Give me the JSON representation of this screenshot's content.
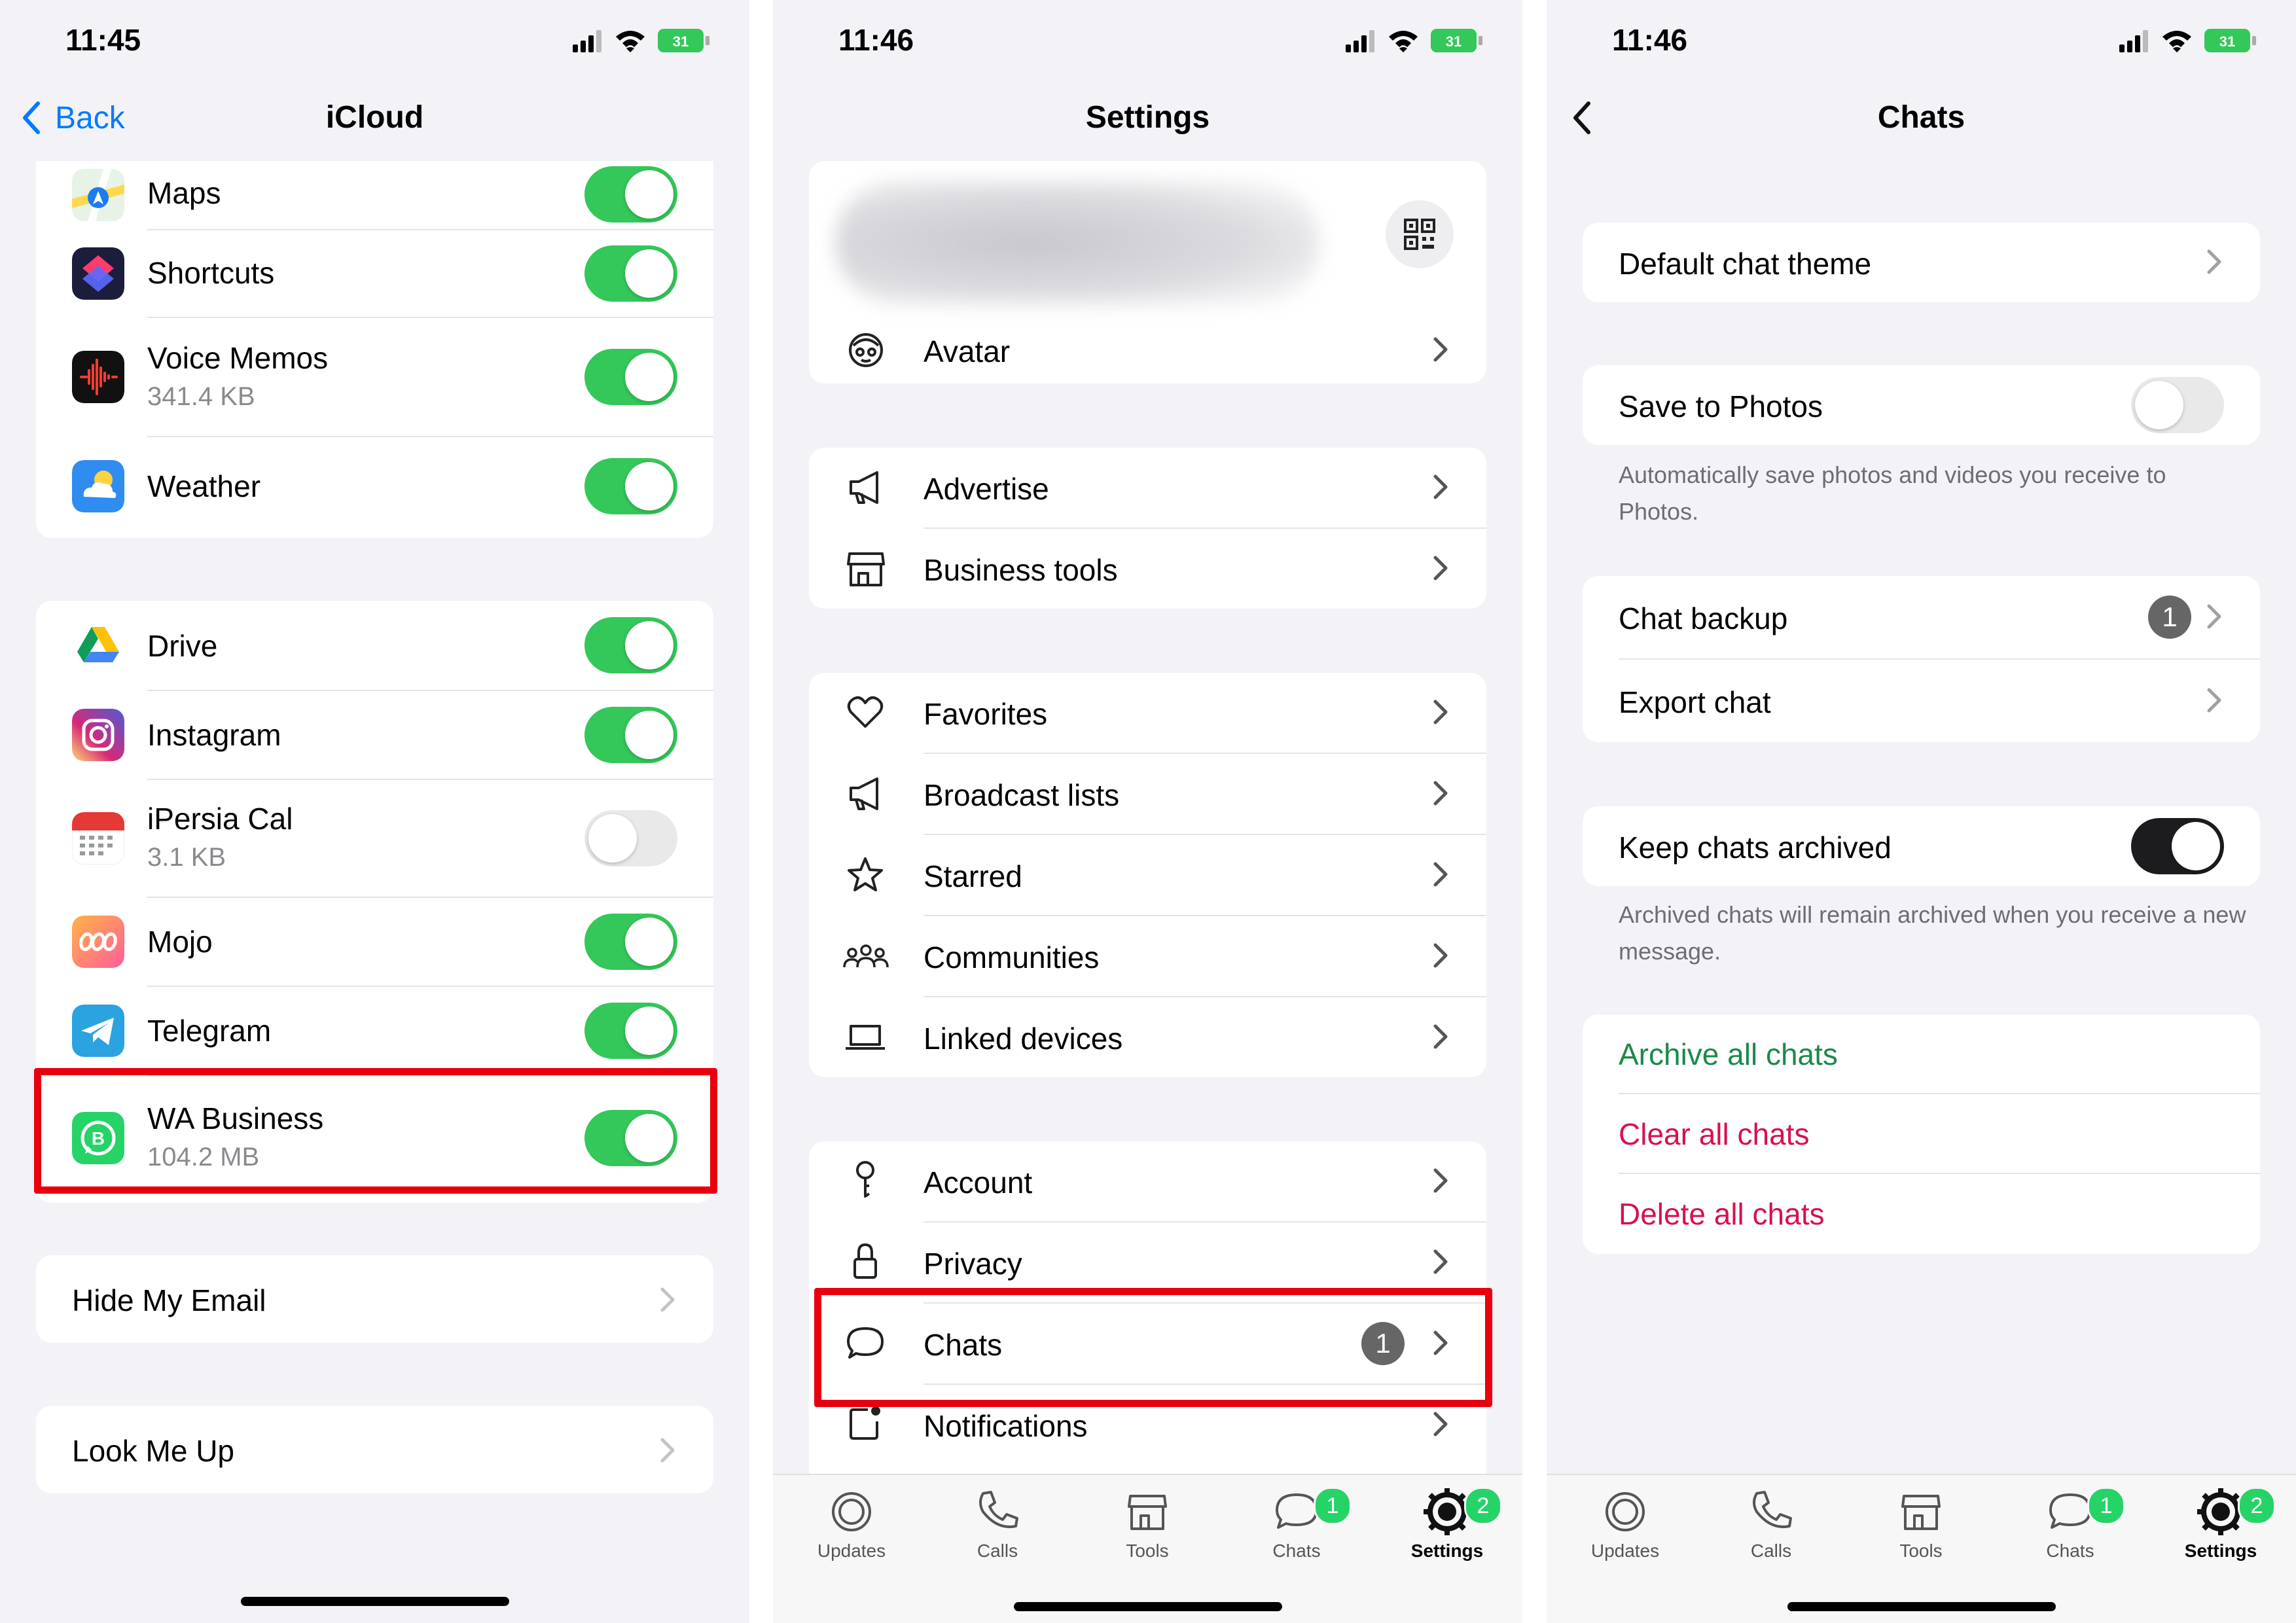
{
  "panels": [
    {
      "time": "11:45",
      "battery": "31",
      "back_label": "Back",
      "title": "iCloud",
      "apps_top": [
        {
          "name": "Maps",
          "icon": "maps-icon",
          "toggle": "on"
        },
        {
          "name": "Shortcuts",
          "icon": "shortcuts-icon",
          "toggle": "on"
        },
        {
          "name": "Voice Memos",
          "detail": "341.4 KB",
          "icon": "voice-memos-icon",
          "toggle": "on"
        },
        {
          "name": "Weather",
          "icon": "weather-icon",
          "toggle": "on"
        }
      ],
      "apps_third_party": [
        {
          "name": "Drive",
          "icon": "drive-icon",
          "toggle": "on"
        },
        {
          "name": "Instagram",
          "icon": "instagram-icon",
          "toggle": "on"
        },
        {
          "name": "iPersia Cal",
          "detail": "3.1 KB",
          "icon": "calendar-icon",
          "toggle": "off"
        },
        {
          "name": "Mojo",
          "icon": "mojo-icon",
          "toggle": "on"
        },
        {
          "name": "Telegram",
          "icon": "telegram-icon",
          "toggle": "on"
        },
        {
          "name": "WA Business",
          "detail": "104.2 MB",
          "icon": "whatsapp-business-icon",
          "toggle": "on",
          "highlighted": true
        }
      ],
      "hide_my_email": "Hide My Email",
      "look_me_up": "Look Me Up"
    },
    {
      "time": "11:46",
      "battery": "31",
      "title": "Settings",
      "avatar_label": "Avatar",
      "business_items": [
        "Advertise",
        "Business tools"
      ],
      "list_items": [
        "Favorites",
        "Broadcast lists",
        "Starred",
        "Communities",
        "Linked devices"
      ],
      "account_items": [
        "Account",
        "Privacy",
        "Chats",
        "Notifications"
      ],
      "chats_badge": "1",
      "tabs": [
        "Updates",
        "Calls",
        "Tools",
        "Chats",
        "Settings"
      ],
      "chats_tab_badge": "1",
      "settings_tab_badge": "2"
    },
    {
      "time": "11:46",
      "battery": "31",
      "title": "Chats",
      "default_theme": "Default chat theme",
      "save_to_photos": "Save to Photos",
      "save_note": "Automatically save photos and videos you receive to Photos.",
      "chat_backup": "Chat backup",
      "chat_backup_badge": "1",
      "export_chat": "Export chat",
      "keep_archived": "Keep chats archived",
      "archived_note": "Archived chats will remain archived when you receive a new message.",
      "archive_all": "Archive all chats",
      "clear_all": "Clear all chats",
      "delete_all": "Delete all chats",
      "tabs": [
        "Updates",
        "Calls",
        "Tools",
        "Chats",
        "Settings"
      ],
      "chats_tab_badge": "1",
      "settings_tab_badge": "2"
    }
  ],
  "colors": {
    "toggle_on": "#34c759",
    "ios_blue": "#007aff",
    "highlight": "#e8000f",
    "wa_green": "#1a8a4a",
    "danger": "#d6114f"
  }
}
